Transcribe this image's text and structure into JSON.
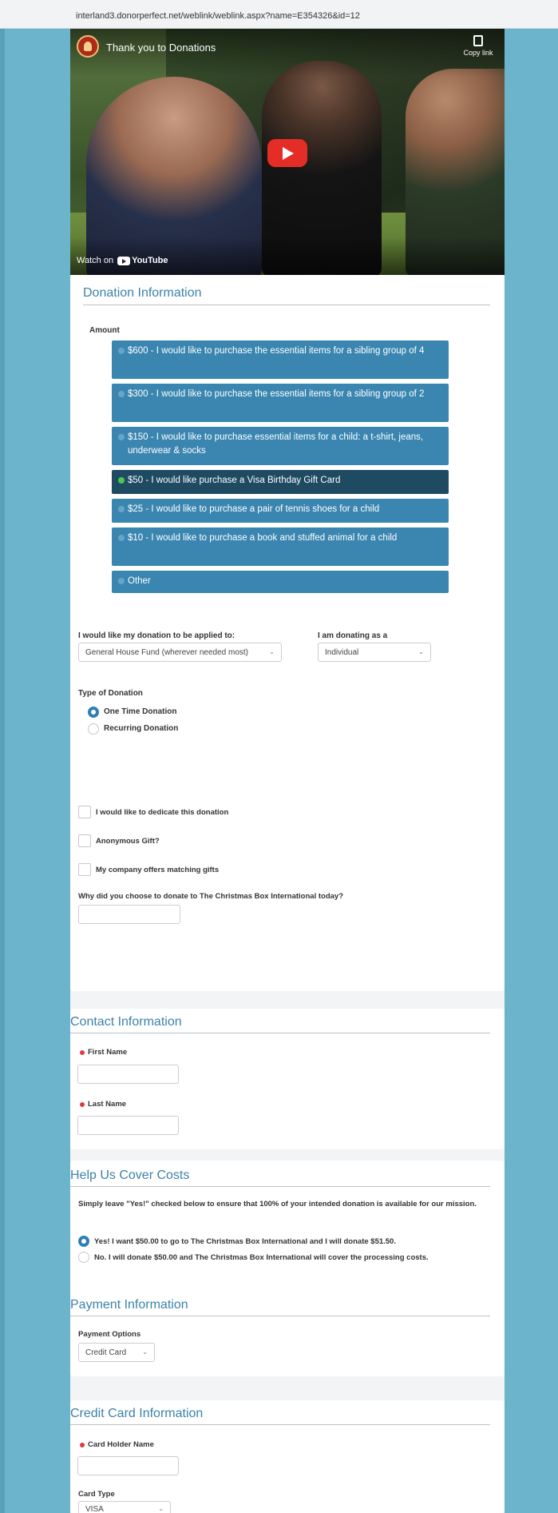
{
  "browser": {
    "url": "interland3.donorperfect.net/weblink/weblink.aspx?name=E354326&id=12"
  },
  "video": {
    "title": "Thank you to Donations",
    "copy_link": "Copy link",
    "watch_on": "Watch on",
    "youtube": "YouTube"
  },
  "donation": {
    "title": "Donation Information",
    "amount_label": "Amount",
    "amounts": [
      {
        "label": "$600 - I would like to purchase the essential items for a sibling group of 4",
        "selected": false
      },
      {
        "label": "$300 - I would like to purchase the essential items for a sibling group of 2",
        "selected": false
      },
      {
        "label": "$150 - I would like to purchase essential items for a child: a t-shirt, jeans, underwear & socks",
        "selected": false
      },
      {
        "label": "$50 - I would like purchase a Visa Birthday Gift Card",
        "selected": true
      },
      {
        "label": "$25 - I would like to purchase a pair of tennis shoes for a child",
        "selected": false
      },
      {
        "label": "$10 - I would like to purchase a book and stuffed animal for a child",
        "selected": false
      },
      {
        "label": "Other",
        "selected": false
      }
    ],
    "applied_label": "I would like my donation to be applied to:",
    "applied_value": "General House Fund (wherever needed most)",
    "donating_as_label": "I am donating as a",
    "donating_as_value": "Individual",
    "type_label": "Type of Donation",
    "type_options": [
      {
        "label": "One Time Donation",
        "selected": true
      },
      {
        "label": "Recurring Donation",
        "selected": false
      }
    ],
    "dedicate_label": "I would like to dedicate this donation",
    "anonymous_label": "Anonymous Gift?",
    "matching_label": "My company offers matching gifts",
    "why_label": "Why did you choose to donate to The Christmas Box International today?"
  },
  "contact": {
    "title": "Contact Information",
    "first_name": "First Name",
    "last_name": "Last Name"
  },
  "costs": {
    "title": "Help Us Cover Costs",
    "description": "Simply leave \"Yes!\" checked below to ensure that 100% of your intended donation is available for our mission.",
    "options": [
      {
        "label": "Yes! I want $50.00 to go to The Christmas Box International and I will donate $51.50.",
        "selected": true
      },
      {
        "label": "No. I will donate $50.00 and The Christmas Box International will cover the processing costs.",
        "selected": false
      }
    ]
  },
  "payment": {
    "title": "Payment Information",
    "options_label": "Payment Options",
    "options_value": "Credit Card"
  },
  "credit_card": {
    "title": "Credit Card Information",
    "holder_label": "Card Holder Name",
    "type_label": "Card Type",
    "type_value": "VISA"
  },
  "icons": {
    "chevron": "⌄",
    "colors": {
      "accent": "#3a86b0",
      "selected": "#1e4a62",
      "required": "#e23a3a",
      "background": "#6cb4cc"
    }
  }
}
